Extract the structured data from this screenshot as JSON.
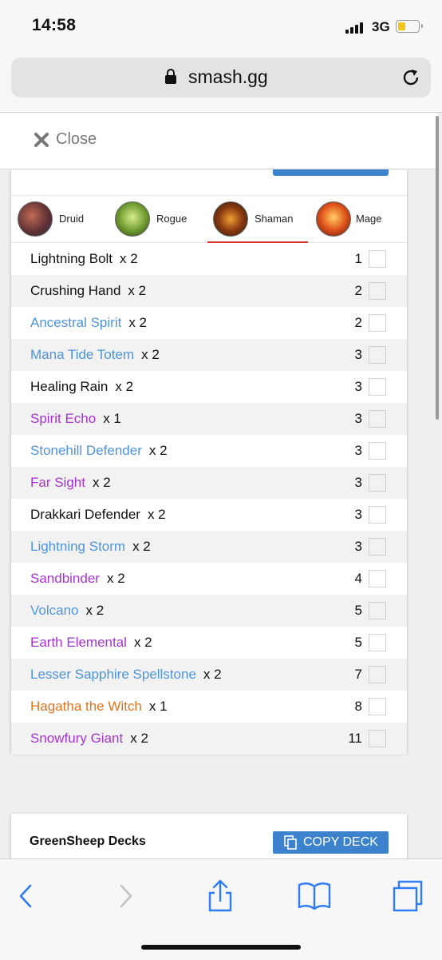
{
  "status_bar": {
    "time": "14:58",
    "network": "3G"
  },
  "browser": {
    "domain": "smash.gg"
  },
  "header": {
    "close_label": "Close"
  },
  "tabs": [
    {
      "label": "Druid",
      "active": false
    },
    {
      "label": "Rogue",
      "active": false
    },
    {
      "label": "Shaman",
      "active": true
    },
    {
      "label": "Mage",
      "active": false
    }
  ],
  "cards": [
    {
      "name": "Lightning Bolt",
      "qty": "x 2",
      "cost": "1",
      "rarity": "common"
    },
    {
      "name": "Crushing Hand",
      "qty": "x 2",
      "cost": "2",
      "rarity": "common"
    },
    {
      "name": "Ancestral Spirit",
      "qty": "x 2",
      "cost": "2",
      "rarity": "rare"
    },
    {
      "name": "Mana Tide Totem",
      "qty": "x 2",
      "cost": "3",
      "rarity": "rare"
    },
    {
      "name": "Healing Rain",
      "qty": "x 2",
      "cost": "3",
      "rarity": "common"
    },
    {
      "name": "Spirit Echo",
      "qty": "x 1",
      "cost": "3",
      "rarity": "epic"
    },
    {
      "name": "Stonehill Defender",
      "qty": "x 2",
      "cost": "3",
      "rarity": "rare"
    },
    {
      "name": "Far Sight",
      "qty": "x 2",
      "cost": "3",
      "rarity": "epic"
    },
    {
      "name": "Drakkari Defender",
      "qty": "x 2",
      "cost": "3",
      "rarity": "common"
    },
    {
      "name": "Lightning Storm",
      "qty": "x 2",
      "cost": "3",
      "rarity": "rare"
    },
    {
      "name": "Sandbinder",
      "qty": "x 2",
      "cost": "4",
      "rarity": "epic"
    },
    {
      "name": "Volcano",
      "qty": "x 2",
      "cost": "5",
      "rarity": "rare"
    },
    {
      "name": "Earth Elemental",
      "qty": "x 2",
      "cost": "5",
      "rarity": "epic"
    },
    {
      "name": "Lesser Sapphire Spellstone",
      "qty": "x 2",
      "cost": "7",
      "rarity": "rare"
    },
    {
      "name": "Hagatha the Witch",
      "qty": "x 1",
      "cost": "8",
      "rarity": "legendary"
    },
    {
      "name": "Snowfury Giant",
      "qty": "x 2",
      "cost": "11",
      "rarity": "epic"
    }
  ],
  "next_deck": {
    "title": "GreenSheep Decks",
    "copy_label": "COPY DECK"
  },
  "colors": {
    "accent": "#3d82cc",
    "tab_underline": "#d8362e",
    "common": "#111111",
    "rare": "#4e94dc",
    "epic": "#a733cf",
    "legendary": "#e1731f"
  },
  "icons": {
    "status": [
      "cellular-signal-icon",
      "battery-icon"
    ],
    "browser": [
      "lock-icon",
      "reload-icon"
    ],
    "toolbar": [
      "back-icon",
      "forward-icon",
      "share-icon",
      "bookmarks-icon",
      "tabs-icon"
    ]
  }
}
